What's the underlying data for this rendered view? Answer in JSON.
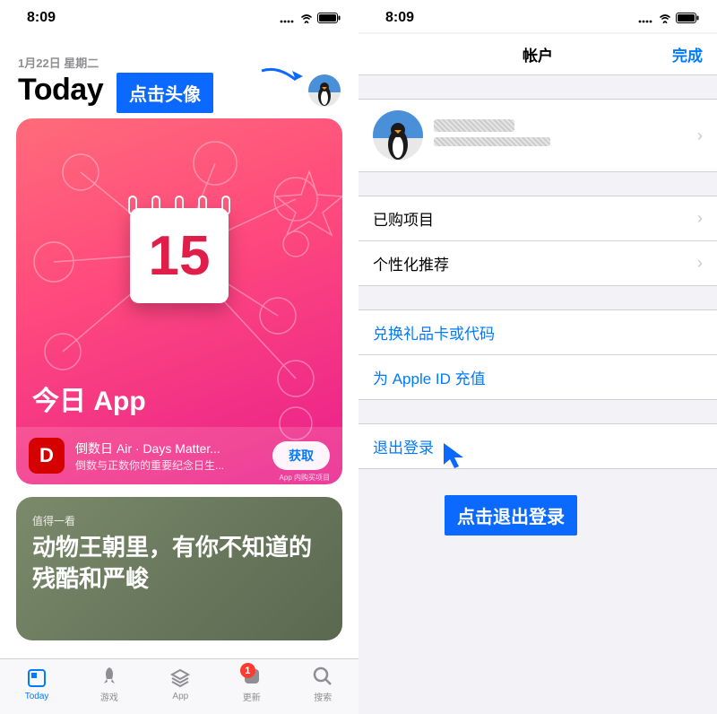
{
  "left": {
    "status_time": "8:09",
    "date": "1月22日 星期二",
    "title": "Today",
    "tooltip": "点击头像",
    "hero": {
      "calendar_number": "15",
      "title": "今日 App"
    },
    "app": {
      "icon_letter": "D",
      "title": "倒数日 Air · Days Matter...",
      "subtitle": "倒数与正数你的重要纪念日生...",
      "get_label": "获取",
      "iap_label": "App 内购买项目"
    },
    "card2": {
      "hint": "值得一看",
      "title": "动物王朝里，有你不知道的残酷和严峻"
    },
    "tabs": [
      {
        "label": "Today",
        "name": "tab-today"
      },
      {
        "label": "游戏",
        "name": "tab-games"
      },
      {
        "label": "App",
        "name": "tab-apps"
      },
      {
        "label": "更新",
        "name": "tab-updates",
        "badge": "1"
      },
      {
        "label": "搜索",
        "name": "tab-search"
      }
    ]
  },
  "right": {
    "status_time": "8:09",
    "nav_title": "帐户",
    "nav_done": "完成",
    "rows": {
      "purchased": "已购项目",
      "personalized": "个性化推荐",
      "redeem": "兑换礼品卡或代码",
      "add_funds": "为 Apple ID 充值",
      "sign_out": "退出登录"
    },
    "tooltip": "点击退出登录"
  }
}
